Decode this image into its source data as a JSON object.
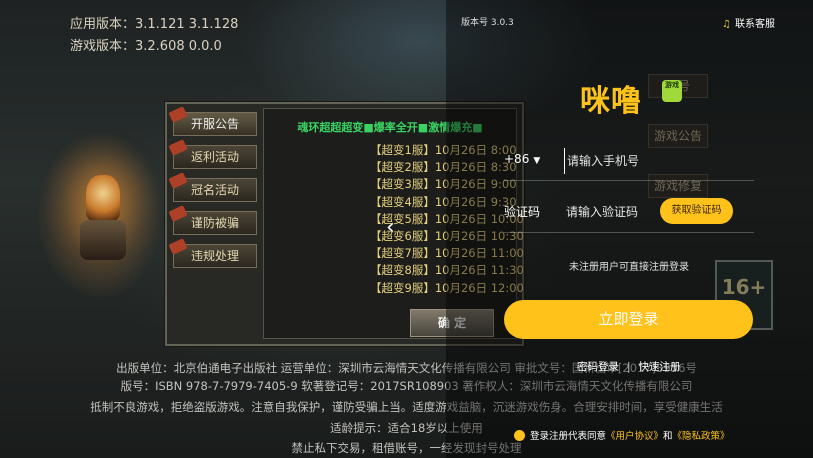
{
  "game": {
    "app_version_label": "应用版本：3.1.121  3.1.128",
    "game_version_label": "游戏版本：3.2.608  0.0.0",
    "notice_tabs": [
      "开服公告",
      "返利活动",
      "冠名活动",
      "谨防被骗",
      "违规处理"
    ],
    "notice_title": "魂环超超超变■爆率全开■激情爆充■",
    "servers": [
      "【超变1服】10月26日 8:00",
      "【超变2服】10月26日 8:30",
      "【超变3服】10月26日 9:00",
      "【超变4服】10月26日 9:30",
      "【超变5服】10月26日 10:00",
      "【超变6服】10月26日 10:30",
      "【超变7服】10月26日 11:00",
      "【超变8服】10月26日 11:30",
      "【超变9服】10月26日 12:00"
    ],
    "confirm_label": "确 定",
    "side_buttons": [
      "账号",
      "游戏公告",
      "游戏修复"
    ],
    "age_rating": "16+",
    "footer_lines": [
      "出版单位：北京伯通电子出版社 运营单位：深圳市云海情天文化传播有限公司 审批文号：国新出审[2017]3956号",
      "版号：ISBN 978-7-7979-7405-9 软著登记号：2017SR108903 著作权人：深圳市云海情天文化传播有限公司",
      "抵制不良游戏，拒绝盗版游戏。注意自我保护，谨防受骗上当。适度游戏益脑，沉迷游戏伤身。合理安排时间，享受健康生活",
      "适龄提示：适合18岁以上使用",
      "禁止私下交易，租借账号，一经发现封号处理"
    ]
  },
  "login": {
    "version_no": "版本号 3.0.3",
    "support_label": "联系客服",
    "logo_text": "咪噜",
    "logo_badge": "游戏",
    "country_code": "+86",
    "phone_placeholder": "请输入手机号",
    "code_label": "验证码",
    "code_placeholder": "请输入验证码",
    "get_code_label": "获取验证码",
    "hint": "未注册用户可直接注册登录",
    "login_button": "立即登录",
    "password_login": "密码登录",
    "quick_register": "快速注册",
    "agreement_prefix": "登录注册代表同意",
    "user_agreement": "《用户协议》",
    "and": "和",
    "privacy_policy": "《隐私政策》"
  }
}
